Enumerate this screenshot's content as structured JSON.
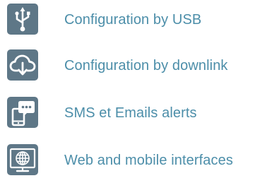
{
  "features": [
    {
      "icon": "usb-icon",
      "label": "Configuration by USB"
    },
    {
      "icon": "cloud-download-icon",
      "label": "Configuration by downlink"
    },
    {
      "icon": "phone-chat-icon",
      "label": "SMS et Emails alerts"
    },
    {
      "icon": "globe-monitor-icon",
      "label": "Web and mobile interfaces"
    }
  ],
  "colors": {
    "icon_background": "#5e7787",
    "label_text": "#4c8ea9"
  }
}
